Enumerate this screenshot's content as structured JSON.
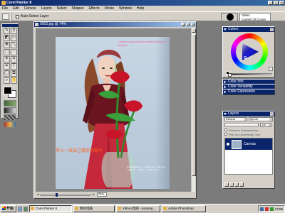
{
  "window": {
    "title": "Corel Painter 8"
  },
  "menu": [
    "File",
    "Edit",
    "Canvas",
    "Layers",
    "Select",
    "Shapes",
    "Effects",
    "Movie",
    "Window",
    "Help"
  ],
  "property_bar": {
    "auto_select_label": "Auto Select Layer"
  },
  "brush_selector": {
    "category": "Oilers",
    "variant": "Camel Oil Cloner"
  },
  "document": {
    "title": "0002.jpg @ 74%",
    "zoom": "74%",
    "photo_headline": "Lorem ipsum dolor sit amet the look of fashion",
    "photo_caption": "导入一张自己喜欢的图片",
    "photo_credits": "Photography by ... Styling by ... Hair and make-up ... Model ... Clothes from ..."
  },
  "panels": {
    "colors": "Colors",
    "color_info": "Color Info",
    "color_variability": "Color Variability",
    "color_expression": "Color Expression",
    "layers": "Layers"
  },
  "layers": {
    "composite_method": "Default",
    "preserve_mode": "Ignore",
    "opacity": "100",
    "preserve_transparency_label": "Preserve Transparency",
    "pick_up_color_label": "Pick Up Underlying Color",
    "items": [
      {
        "name": "Canvas"
      }
    ]
  },
  "taskbar": {
    "start": "开始",
    "tasks": [
      "Corel Painter 8",
      "我的电脑",
      "Yahoo!电邮 - assuing...",
      "Adobe Photoshop"
    ],
    "clock": "17:05"
  },
  "colors": {
    "accent": "#0a246a",
    "chrome": "#d4d0c8",
    "caption": "#ff5c1a",
    "headline": "#e85aa0"
  }
}
